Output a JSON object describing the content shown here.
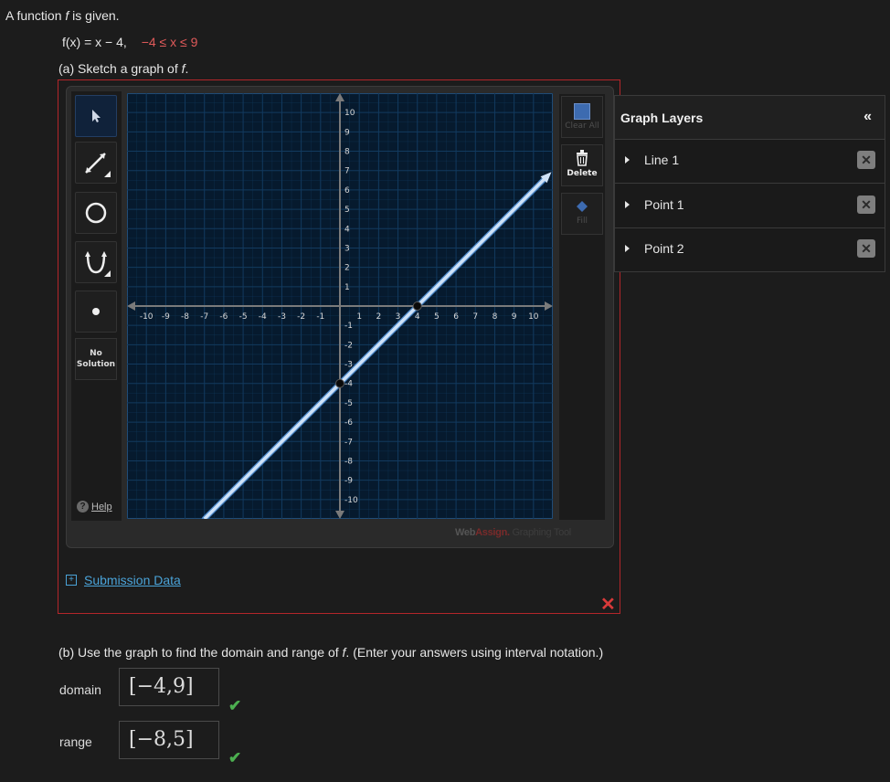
{
  "intro": {
    "prefix": "A function ",
    "var": "f",
    "suffix": " is given."
  },
  "function": {
    "lhs": "f(x) = x − 4,",
    "domain_cond": "−4 ≤ x ≤ 9"
  },
  "part_a": {
    "text": "(a) Sketch a graph of ",
    "var": "f",
    "end": "."
  },
  "toolbar": {
    "tools": [
      "pointer-tool",
      "line-tool",
      "circle-tool",
      "parabola-tool",
      "point-tool"
    ],
    "no_solution_line1": "No",
    "no_solution_line2": "Solution",
    "help_label": "Help"
  },
  "right_tools": {
    "clear_all": "Clear All",
    "delete": "Delete",
    "fill": "Fill"
  },
  "brand": {
    "web": "Web",
    "assign": "Assign.",
    "graphing": " Graphing Tool"
  },
  "graph": {
    "xlim": [
      -11,
      11
    ],
    "ylim": [
      -11,
      11
    ],
    "x_ticks": [
      -10,
      -9,
      -8,
      -7,
      -6,
      -5,
      -4,
      -3,
      -2,
      -1,
      1,
      2,
      3,
      4,
      5,
      6,
      7,
      8,
      9,
      10
    ],
    "y_ticks": [
      10,
      9,
      8,
      7,
      6,
      5,
      4,
      3,
      2,
      1,
      -1,
      -2,
      -3,
      -4,
      -5,
      -6,
      -7,
      -8,
      -9,
      -10
    ],
    "line": {
      "slope": 1,
      "intercept": -4,
      "x_start": -7,
      "x_end": 11
    },
    "points": [
      [
        0,
        -4
      ],
      [
        4,
        0
      ]
    ],
    "colors": {
      "bg": "#061a2e",
      "grid": "#123a5f",
      "axis": "#7a7a7a",
      "line": "#cfe2f7"
    }
  },
  "submission_label": "Submission Data",
  "incorrect_mark": "✕",
  "layers": {
    "title": "Graph Layers",
    "collapse": "«",
    "items": [
      {
        "name": "Line 1"
      },
      {
        "name": "Point 1"
      },
      {
        "name": "Point 2"
      }
    ],
    "delete_glyph": "✕"
  },
  "part_b": {
    "text_prefix": "(b) Use the graph to find the domain and range of ",
    "var": "f",
    "text_suffix": ". (Enter your answers using interval notation.)"
  },
  "domain": {
    "label": "domain",
    "value": "[−4,9]",
    "status": "✔"
  },
  "range": {
    "label": "range",
    "value": "[−8,5]",
    "status": "✔"
  }
}
